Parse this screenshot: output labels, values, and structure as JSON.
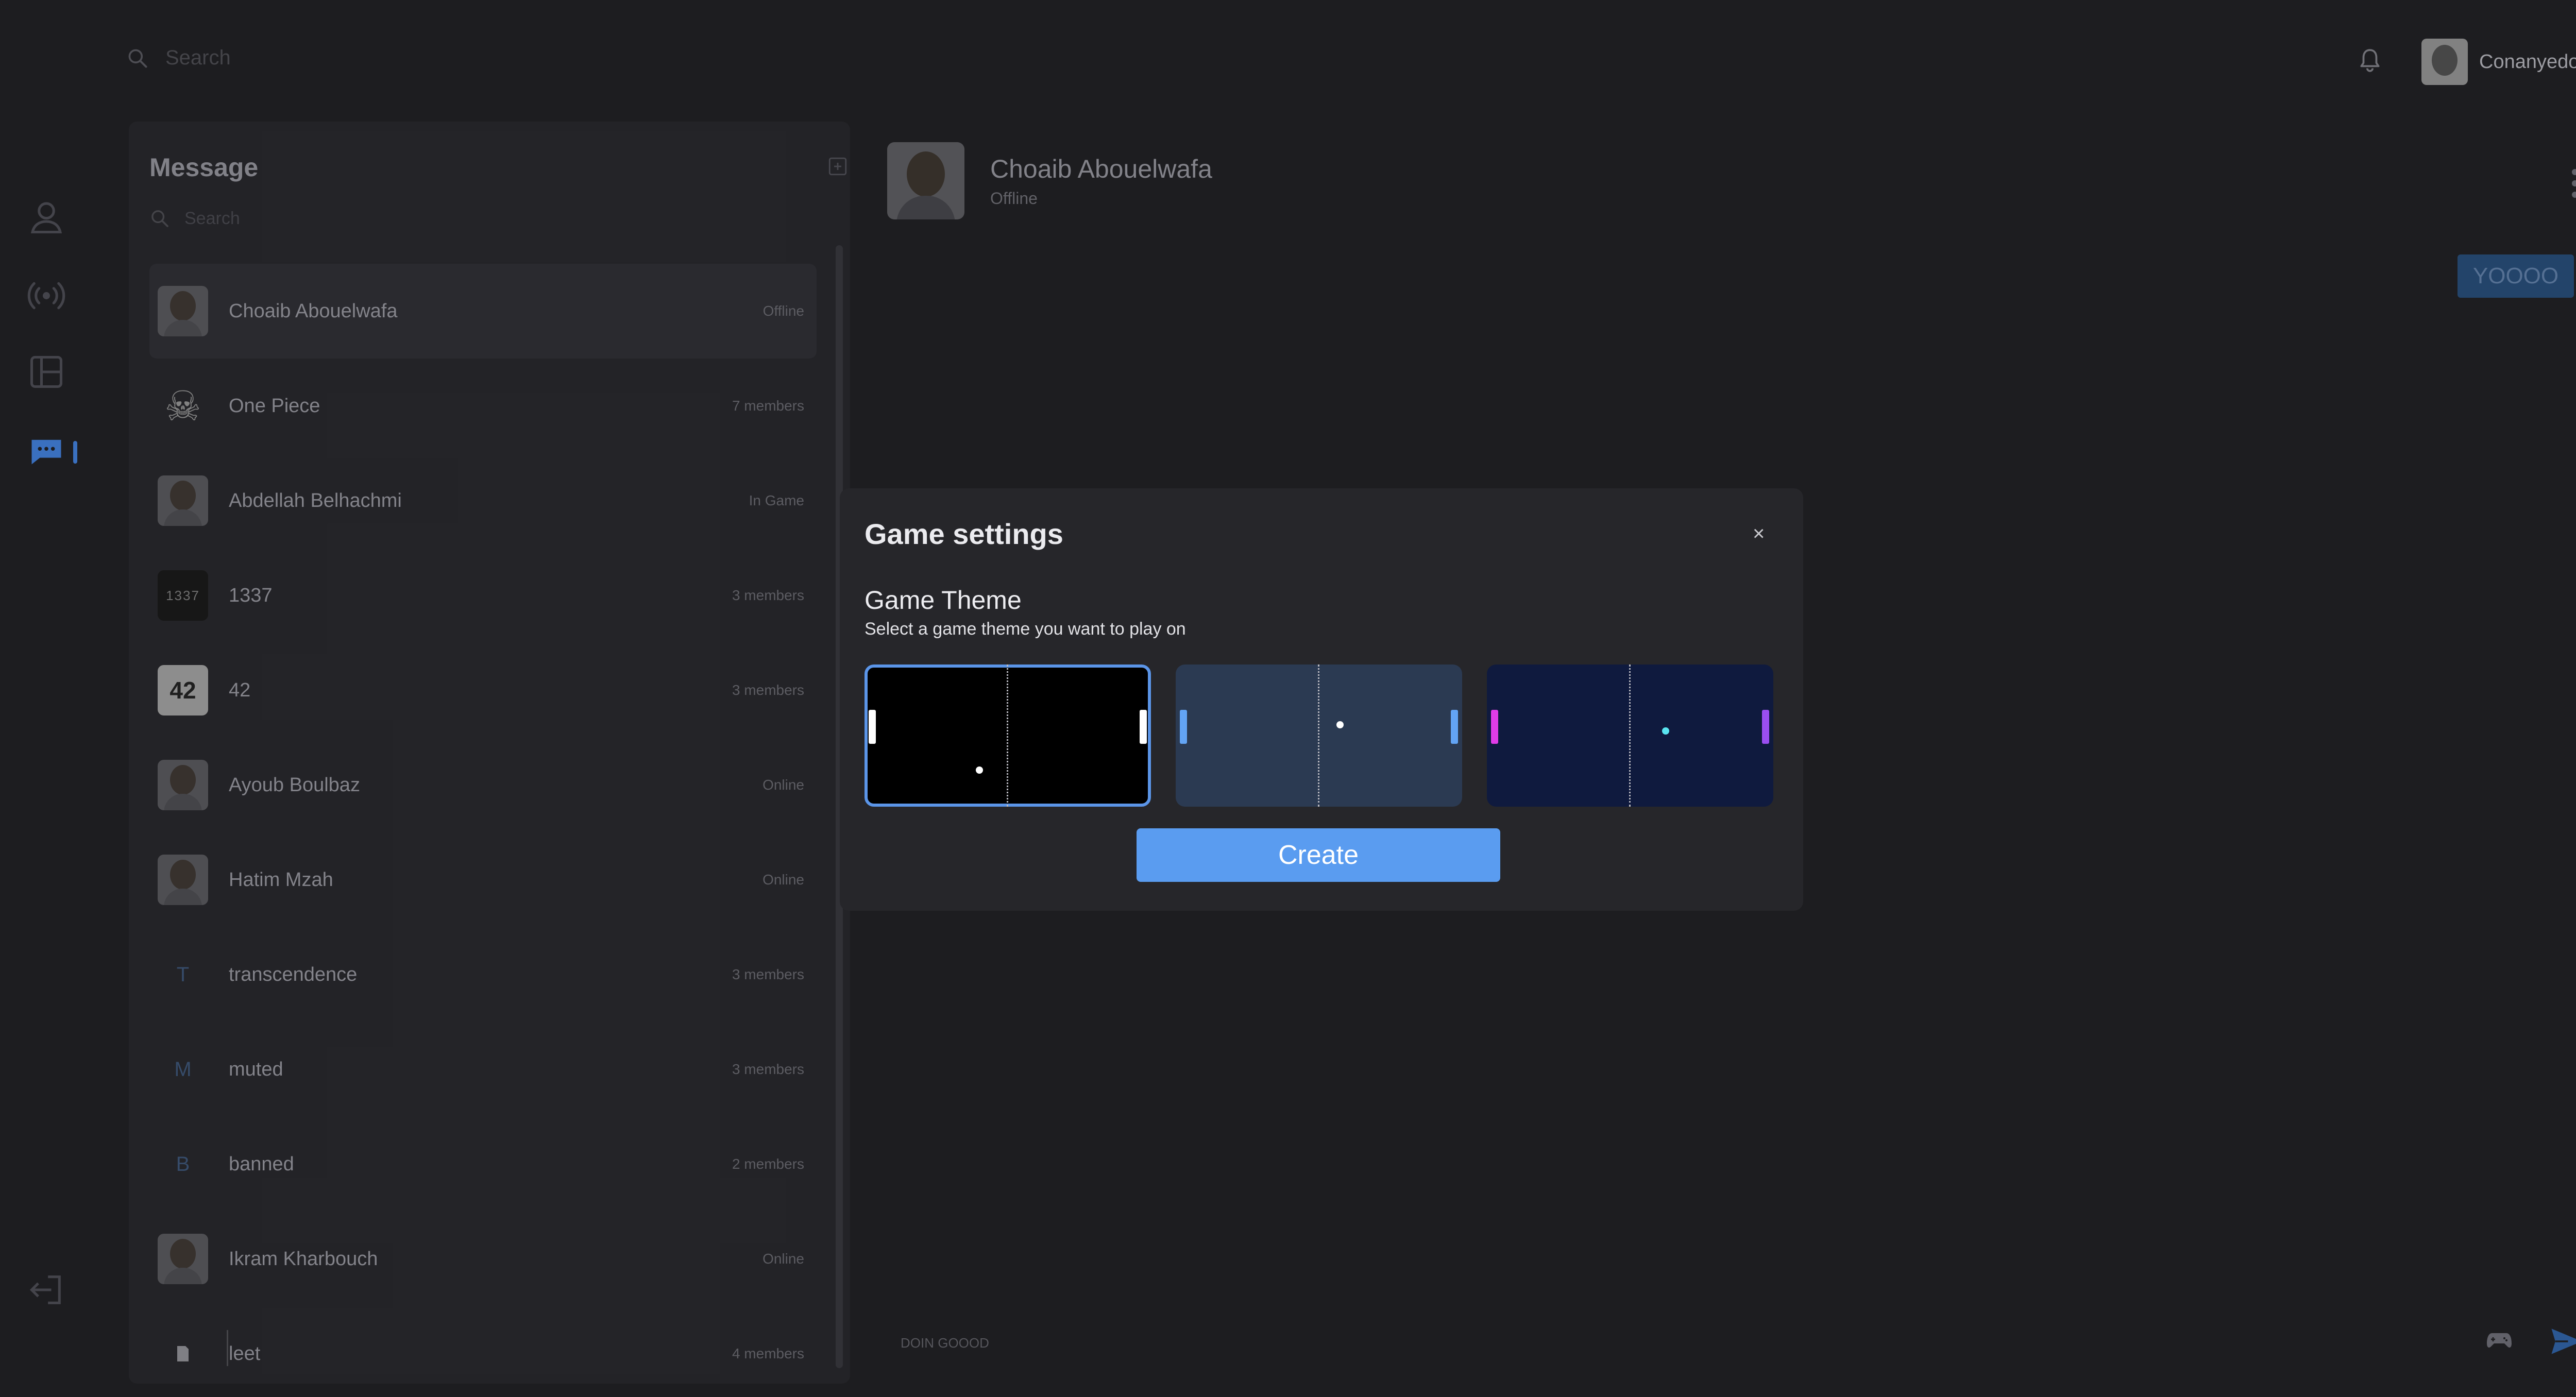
{
  "topbar": {
    "search_placeholder": "Search",
    "username": "Conanyedo"
  },
  "sidebar_rail": {
    "icons": [
      "profile-icon",
      "live-stream-icon",
      "leaderboard-icon",
      "chat-icon",
      "logout-icon"
    ],
    "active": "chat-icon"
  },
  "messages": {
    "title": "Message",
    "search_placeholder": "Search",
    "chats": [
      {
        "name": "Choaib Abouelwafa",
        "meta": "Offline",
        "avatar": "person",
        "selected": true
      },
      {
        "name": "One Piece",
        "meta": "7 members",
        "avatar": "skull",
        "avatar_text": "☠"
      },
      {
        "name": "Abdellah Belhachmi",
        "meta": "In Game",
        "avatar": "person"
      },
      {
        "name": "1337",
        "meta": "3 members",
        "avatar": "dark",
        "avatar_text": "1337"
      },
      {
        "name": "42",
        "meta": "3 members",
        "avatar": "light",
        "avatar_text": "42"
      },
      {
        "name": "Ayoub Boulbaz",
        "meta": "Online",
        "avatar": "person"
      },
      {
        "name": "Hatim Mzah",
        "meta": "Online",
        "avatar": "person"
      },
      {
        "name": "transcendence",
        "meta": "3 members",
        "avatar": "letter",
        "avatar_text": "T"
      },
      {
        "name": "muted",
        "meta": "3 members",
        "avatar": "letter",
        "avatar_text": "M"
      },
      {
        "name": "banned",
        "meta": "2 members",
        "avatar": "letter",
        "avatar_text": "B"
      },
      {
        "name": "Ikram Kharbouch",
        "meta": "Online",
        "avatar": "person"
      },
      {
        "name": "leet",
        "meta": "4 members",
        "avatar": "doc"
      }
    ]
  },
  "chat": {
    "contact_name": "Choaib Abouelwafa",
    "contact_status": "Offline",
    "messages": [
      {
        "text": "YOOOO"
      }
    ],
    "composer_text": "DOIN GOOOD"
  },
  "modal": {
    "title": "Game settings",
    "close_label": "×",
    "section_title": "Game Theme",
    "section_subtitle": "Select a game theme you want to play on",
    "themes": [
      {
        "id": "classic",
        "background": "#000000",
        "left_paddle": "#ffffff",
        "right_paddle": "#ffffff",
        "ball": "#ffffff",
        "selected": true
      },
      {
        "id": "slate",
        "background": "#2b3a52",
        "left_paddle": "#63a4f4",
        "right_paddle": "#63a4f4",
        "ball": "#ffffff",
        "selected": false
      },
      {
        "id": "neon",
        "background": "#0f1a3e",
        "left_paddle": "#e03ce8",
        "right_paddle": "#9a4ef0",
        "ball": "#59e4f0",
        "selected": false
      }
    ],
    "create_label": "Create"
  },
  "colors": {
    "background": "#202023",
    "panel": "#27272b",
    "accent": "#5a9cf0",
    "modal": "#26262a"
  }
}
